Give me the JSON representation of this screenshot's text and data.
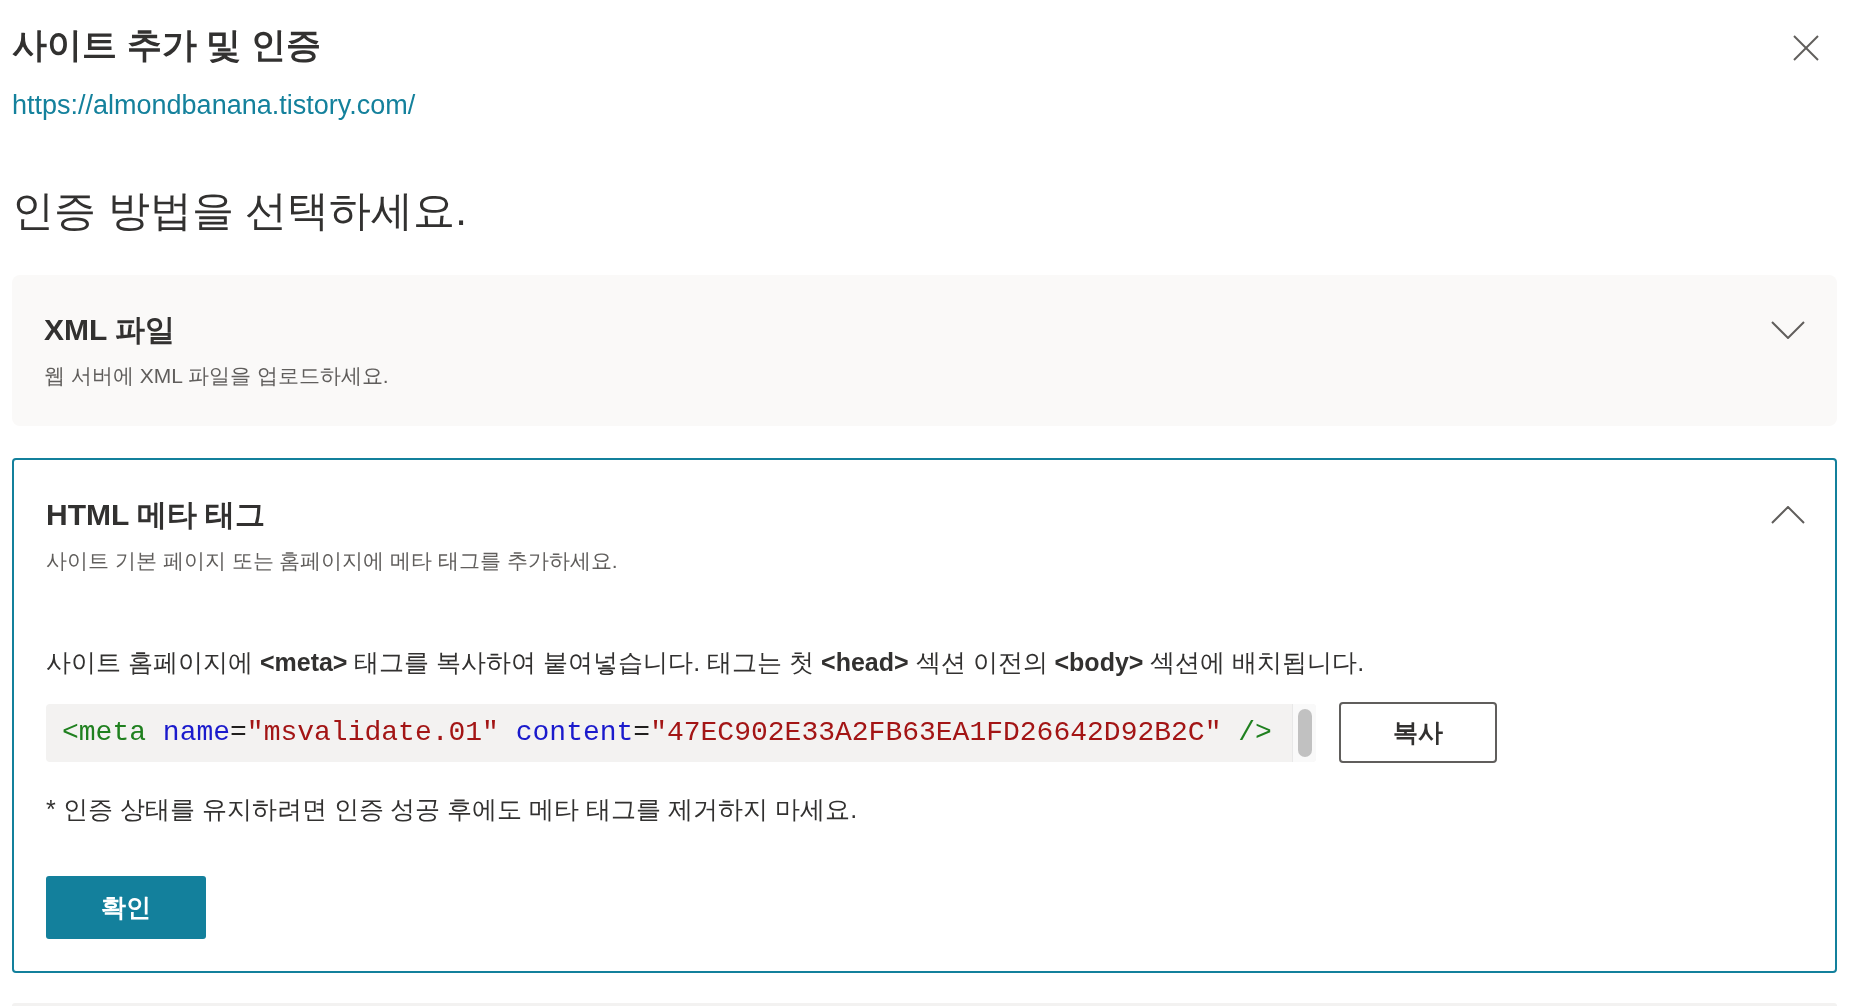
{
  "dialog": {
    "title": "사이트 추가 및 인증",
    "site_url": "https://almondbanana.tistory.com/"
  },
  "heading": "인증 방법을 선택하세요.",
  "methods": [
    {
      "title": "XML 파일",
      "description": "웹 서버에 XML 파일을 업로드하세요.",
      "expanded": false
    },
    {
      "title": "HTML 메타 태그",
      "description": "사이트 기본 페이지 또는 홈페이지에 메타 태그를 추가하세요.",
      "expanded": true,
      "instructions": "사이트 홈페이지에 **<meta>** 태그를 복사하여 붙여넣습니다. 태그는 첫 **<head>** 섹션 이전의 **<body>** 섹션에 배치됩니다.",
      "code": {
        "groups": [
          {
            "tokens": [
              {
                "kind": "tag",
                "text": "<meta"
              }
            ]
          },
          {
            "tokens": [
              {
                "kind": "attribute",
                "text": "name"
              },
              {
                "kind": "punctuation",
                "text": "="
              },
              {
                "kind": "string",
                "text": "\"msvalidate.01\""
              }
            ]
          },
          {
            "tokens": [
              {
                "kind": "attribute",
                "text": "content"
              },
              {
                "kind": "punctuation",
                "text": "="
              },
              {
                "kind": "string",
                "text": "\"47EC902E33A2FB63EA1FD26642D92B2C\""
              }
            ]
          },
          {
            "tokens": [
              {
                "kind": "tag",
                "text": "/>"
              }
            ]
          }
        ]
      },
      "copy_button": "복사",
      "note": "* 인증 상태를 유지하려면 인증 성공 후에도 메타 태그를 제거하지 마세요.",
      "confirm_button": "확인"
    }
  ]
}
